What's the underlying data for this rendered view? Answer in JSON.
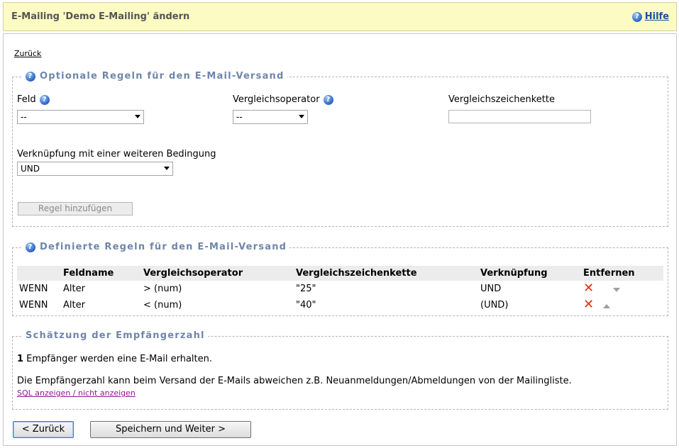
{
  "header": {
    "title": "E-Mailing 'Demo E-Mailing' ändern",
    "help": "Hilfe"
  },
  "back_link": "Zurück",
  "optional_rules": {
    "legend": "Optionale Regeln für den E-Mail-Versand",
    "field_label": "Feld",
    "field_value": "--",
    "operator_label": "Vergleichsoperator",
    "operator_value": "--",
    "compare_label": "Vergleichszeichenkette",
    "compare_value": "",
    "link_label": "Verknüpfung mit einer weiteren Bedingung",
    "link_value": "UND",
    "add_button": "Regel hinzufügen"
  },
  "defined_rules": {
    "legend": "Definierte Regeln für den E-Mail-Versand",
    "columns": [
      "",
      "Feldname",
      "Vergleichsoperator",
      "Vergleichszeichenkette",
      "Verknüpfung",
      "Entfernen"
    ],
    "rows": [
      {
        "prefix": "WENN",
        "field": "Alter",
        "operator": "> (num)",
        "value": "\"25\"",
        "link": "UND"
      },
      {
        "prefix": "WENN",
        "field": "Alter",
        "operator": "< (num)",
        "value": "\"40\"",
        "link": "(UND)"
      }
    ]
  },
  "estimate": {
    "legend": "Schätzung der Empfängerzahl",
    "count": "1",
    "count_text": " Empfänger werden eine E-Mail erhalten.",
    "note": "Die Empfängerzahl kann beim Versand der E-Mails abweichen z.B. Neuanmeldungen/Abmeldungen von der Mailingliste.",
    "sql_link": "SQL anzeigen / nicht anzeigen"
  },
  "buttons": {
    "back": "< Zurück",
    "save": "Speichern und Weiter >"
  },
  "icons": {
    "help": "help-icon",
    "remove": "remove-x-icon",
    "move_down": "move-down-icon",
    "move_up": "move-up-icon"
  },
  "colors": {
    "header_bg": "#fdfbc4",
    "legend_text": "#6f86a8",
    "link_blue": "#1a4fa0",
    "remove_red": "#e03010"
  }
}
